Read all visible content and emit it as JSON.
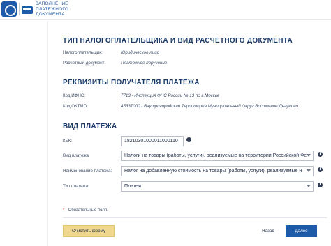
{
  "header": {
    "logo_lines": [
      "ЗАПОЛНЕНИЕ",
      "ПЛАТЕЖНОГО",
      "ДОКУМЕНТА"
    ]
  },
  "section_payer": {
    "title": "ТИП НАЛОГОПЛАТЕЛЬЩИКА И ВИД РАСЧЕТНОГО ДОКУМЕНТА",
    "rows": [
      {
        "label": "Налогоплательщик:",
        "value": "Юридическое лицо"
      },
      {
        "label": "Расчетный документ:",
        "value": "Платежное поручение"
      }
    ]
  },
  "section_recipient": {
    "title": "РЕКВИЗИТЫ ПОЛУЧАТЕЛЯ ПЛАТЕЖА",
    "rows": [
      {
        "label": "Код ИФНС:",
        "value": "7713 - Инспекция ФНС России № 13 по г.Москве"
      },
      {
        "label": "Код ОКТМО:",
        "value": "45337000 - Внутригородская Территория Муниципальный Округ Восточное Дегунино"
      }
    ]
  },
  "section_payment": {
    "title": "ВИД ПЛАТЕЖА",
    "kbk": {
      "label": "КБК:",
      "value": "18210301000011000110"
    },
    "payment_kind": {
      "label": "Вид платежа:",
      "value": "Налоги на товары (работы, услуги), реализуемые на территории Российской Фе"
    },
    "payment_name": {
      "label": "Наименование платежа:",
      "value": "Налог на добавленную стоимость на товары (работы, услуги), реализуемые н"
    },
    "payment_type": {
      "label": "Тип платежа:",
      "value": "Платеж"
    }
  },
  "footer": {
    "required_star": "*",
    "required_text": "- Обязательные поля.",
    "clear_label": "Очистить форму",
    "back_label": "Назад",
    "next_label": "Далее"
  },
  "icons": {
    "info": "info-icon",
    "caret": "chevron-down-icon"
  },
  "colors": {
    "brand": "#1d5aa8",
    "title": "#1a3a68",
    "clear_button": "#efd88e",
    "required": "#d0312d"
  }
}
